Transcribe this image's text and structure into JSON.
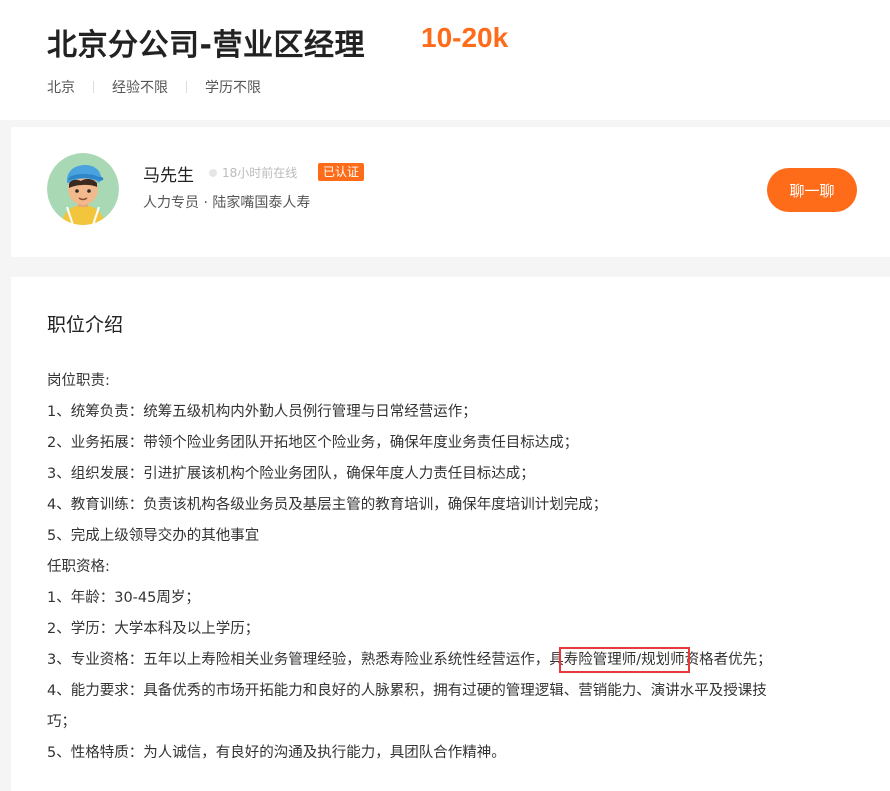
{
  "job": {
    "title": "北京分公司-营业区经理",
    "salary": "10-20k",
    "tags": [
      "北京",
      "经验不限",
      "学历不限"
    ]
  },
  "recruiter": {
    "name": "马先生",
    "online_status": "18小时前在线",
    "verified_label": "已认证",
    "info": "人力专员 · 陆家嘴国泰人寿",
    "chat_button": "聊一聊"
  },
  "description": {
    "section_title": "职位介绍",
    "lines": [
      "岗位职责:",
      "1、统筹负责：统筹五级机构内外勤人员例行管理与日常经营运作；",
      "2、业务拓展：带领个险业务团队开拓地区个险业务，确保年度业务责任目标达成；",
      "3、组织发展：引进扩展该机构个险业务团队，确保年度人力责任目标达成；",
      "4、教育训练：负责该机构各级业务员及基层主管的教育培训，确保年度培训计划完成；",
      "5、完成上级领导交办的其他事宜",
      "任职资格:",
      "1、年龄：30-45周岁；",
      "2、学历：大学本科及以上学历；"
    ],
    "line_qual_3_before": "3、专业资格：五年以上寿险相关业务管理经验，熟悉寿险业系统性经营运作，具",
    "line_qual_3_highlight": "寿险管理师/规划师",
    "line_qual_3_after": "资格者优先；",
    "line_qual_4a": "4、能力要求：具备优秀的市场开拓能力和良好的人脉累积，拥有过硬的管理逻辑、营销能力、演讲水平及授课技",
    "line_qual_4b": "巧；",
    "line_qual_5": "5、性格特质：为人诚信，有良好的沟通及执行能力，具团队合作精神。"
  }
}
